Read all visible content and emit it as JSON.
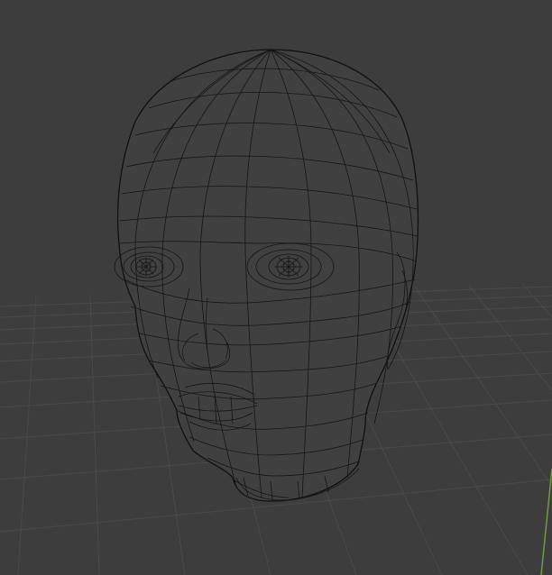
{
  "viewport": {
    "background_color": "#3d3d3d",
    "grid_color": "#4a4a4a",
    "wire_color": "#101010",
    "wire_fill": "#404040",
    "axis_y_color": "#6f9b3b"
  },
  "mesh": {
    "type": "head-wireframe",
    "edit_mode": "wireframe-overlay"
  }
}
